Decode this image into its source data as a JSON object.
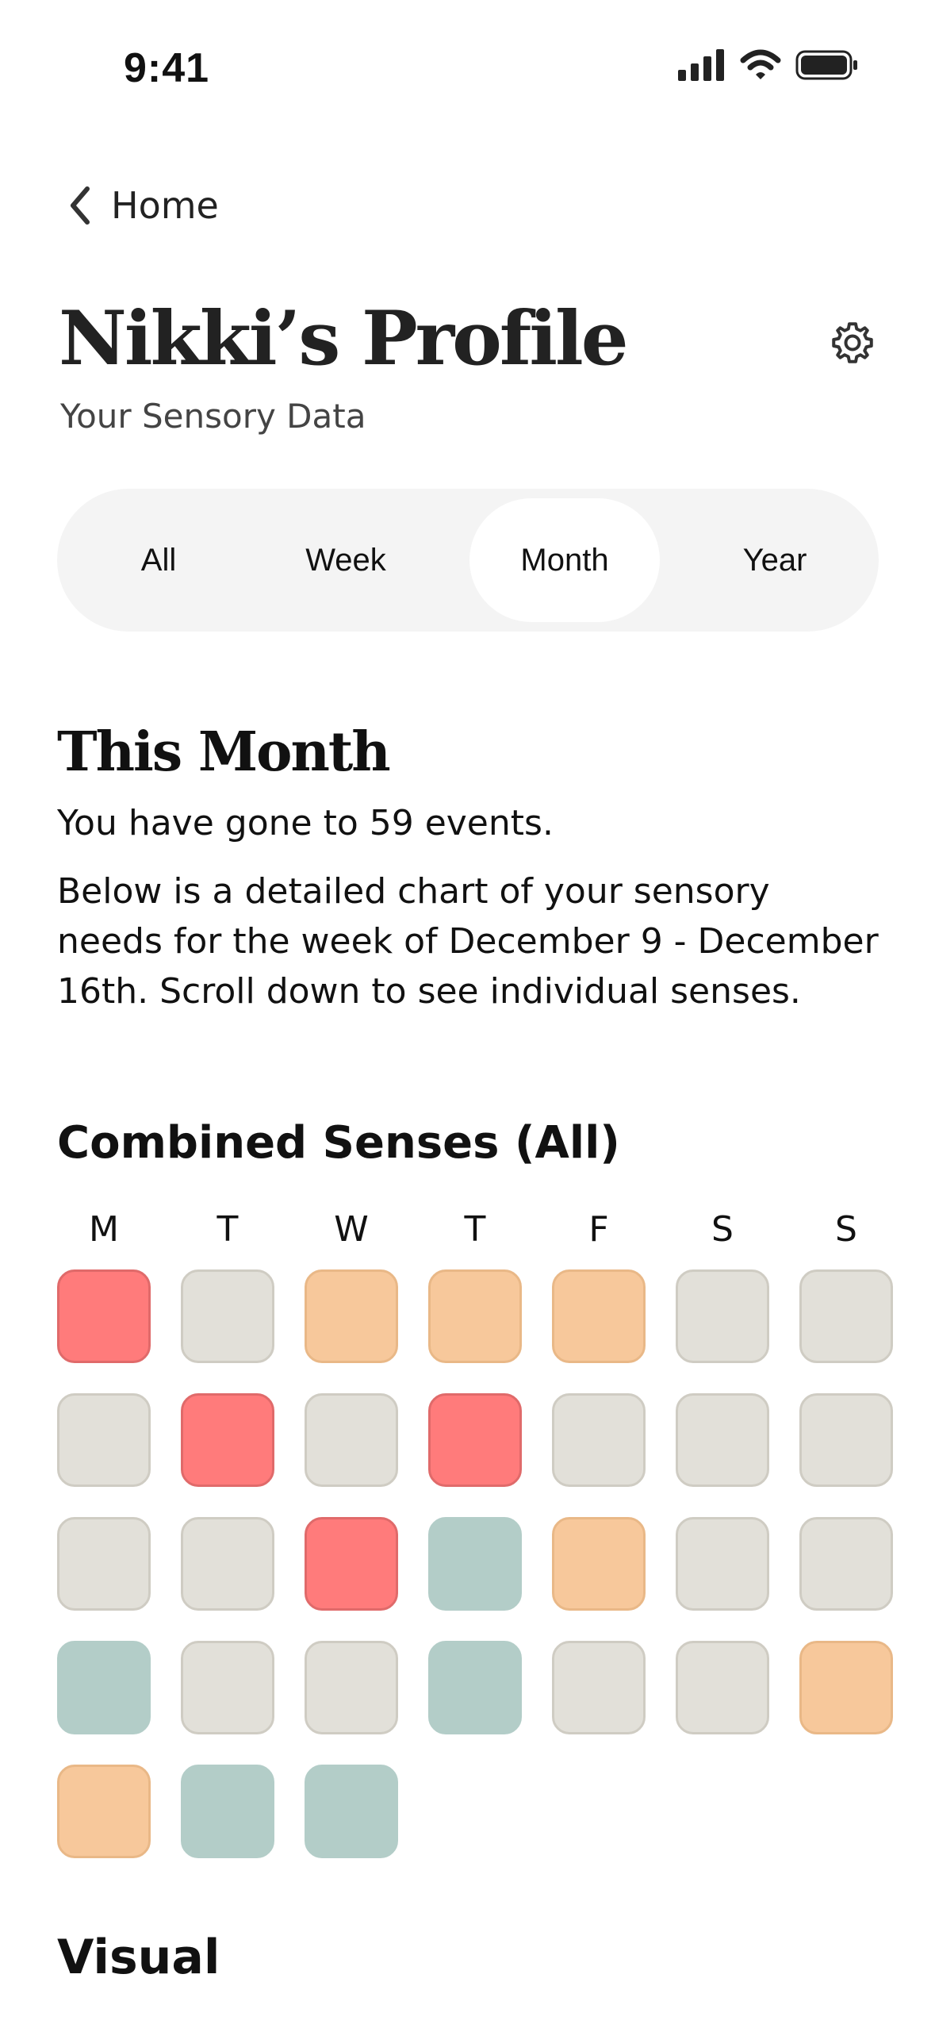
{
  "status_bar": {
    "time": "9:41"
  },
  "nav": {
    "back_label": "Home"
  },
  "header": {
    "title": "Nikki’s Profile",
    "subtitle": "Your Sensory Data"
  },
  "tabs": [
    {
      "label": "All",
      "selected": false
    },
    {
      "label": "Week",
      "selected": false
    },
    {
      "label": "Month",
      "selected": true
    },
    {
      "label": "Year",
      "selected": false
    }
  ],
  "section": {
    "title": "This Month",
    "summary": "You have gone to 59 events.",
    "description": "Below is a detailed chart of your sensory needs for the week of December 9 - December 16th. Scroll down to see individual senses."
  },
  "combined": {
    "title": "Combined Senses (All)",
    "weekdays": [
      "M",
      "T",
      "W",
      "T",
      "F",
      "S",
      "S"
    ],
    "levels": {
      "high": {
        "fill": "#ff7b7b",
        "border": "#e06a6a"
      },
      "medium": {
        "fill": "#f7c89b",
        "border": "#e9b887"
      },
      "low": {
        "fill": "#b3cdc8",
        "border": "#b3cdc8"
      },
      "none": {
        "fill": "#e2e0d9",
        "border": "#cfccc3"
      }
    },
    "cells": [
      [
        "high",
        "none",
        "medium",
        "medium",
        "medium",
        "none",
        "none"
      ],
      [
        "none",
        "high",
        "none",
        "high",
        "none",
        "none",
        "none"
      ],
      [
        "none",
        "none",
        "high",
        "low",
        "medium",
        "none",
        "none"
      ],
      [
        "low",
        "none",
        "none",
        "low",
        "none",
        "none",
        "medium"
      ],
      [
        "medium",
        "low",
        "low"
      ]
    ]
  },
  "visual": {
    "title": "Visual"
  }
}
